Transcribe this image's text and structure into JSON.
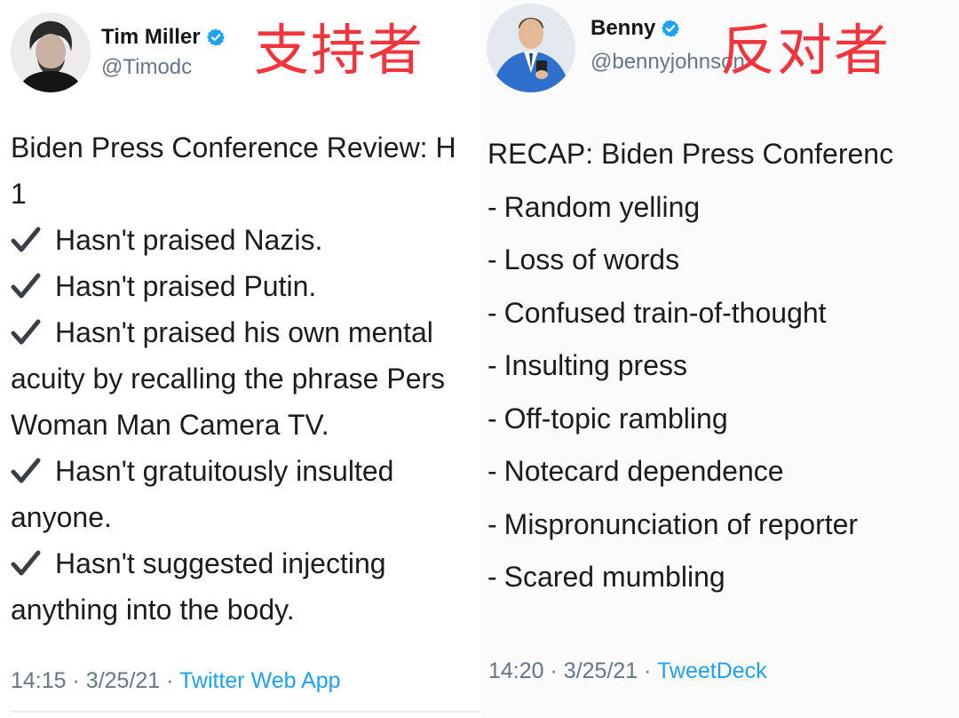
{
  "left_tweet": {
    "display_name": "Tim Miller",
    "handle": "@Timodc",
    "stance_label": "支持者",
    "body_lines": [
      {
        "check": false,
        "text": "Biden Press Conference Review: H"
      },
      {
        "check": false,
        "text": "1"
      },
      {
        "check": true,
        "text": "Hasn't praised Nazis."
      },
      {
        "check": true,
        "text": "Hasn't praised Putin."
      },
      {
        "check": true,
        "text": "Hasn't praised his own mental"
      },
      {
        "check": false,
        "text": "acuity by recalling the phrase Pers"
      },
      {
        "check": false,
        "text": "Woman Man Camera TV."
      },
      {
        "check": true,
        "text": "Hasn't gratuitously insulted"
      },
      {
        "check": false,
        "text": "anyone."
      },
      {
        "check": true,
        "text": "Hasn't suggested injecting"
      },
      {
        "check": false,
        "text": "anything into the body."
      }
    ],
    "time": "14:15",
    "date": "3/25/21",
    "separator": "·",
    "source": "Twitter Web App"
  },
  "right_tweet": {
    "display_name": "Benny",
    "handle": "@bennyjohnson",
    "stance_label": "反对者",
    "title": "RECAP: Biden Press Conferenc",
    "list_items": [
      "Random yelling",
      "Loss of words",
      "Confused train-of-thought",
      "Insulting press",
      "Off-topic rambling",
      "Notecard dependence",
      "Mispronunciation of reporter",
      "Scared mumbling"
    ],
    "time": "14:20",
    "date": "3/25/21",
    "separator": "·",
    "source": "TweetDeck"
  },
  "icons": {
    "verified": "verified-badge-icon",
    "check": "checkmark-icon"
  },
  "colors": {
    "verified_blue": "#1da1f2",
    "link_blue": "#1da1f2",
    "stance_red": "#f2343c",
    "meta_gray": "#657786"
  }
}
